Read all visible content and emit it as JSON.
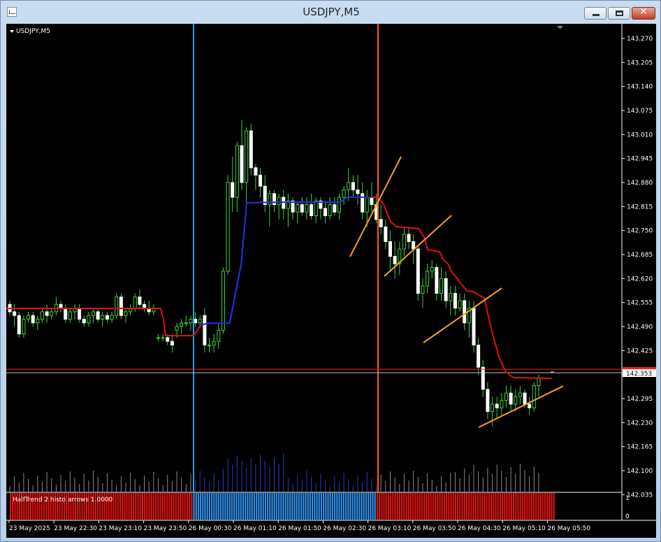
{
  "window": {
    "title": "USDJPY,M5"
  },
  "chart": {
    "symbol_label": "USDJPY,M5",
    "current_price_label": "142.353",
    "price_axis_labels": [
      "143.270",
      "143.205",
      "143.140",
      "143.075",
      "143.010",
      "142.945",
      "142.880",
      "142.815",
      "142.750",
      "142.685",
      "142.620",
      "142.555",
      "142.490",
      "142.425",
      "142.360",
      "142.295",
      "142.230",
      "142.165",
      "142.100",
      "142.035"
    ],
    "time_axis_labels": [
      "23 May 2025",
      "23 May 22:30",
      "23 May 23:10",
      "23 May 23:50",
      "26 May 00:30",
      "26 May 01:10",
      "26 May 01:50",
      "26 May 02:30",
      "26 May 03:10",
      "26 May 03:50",
      "26 May 04:30",
      "26 May 05:10",
      "26 May 05:50"
    ],
    "indicator_label": "HalfTrend 2 histo arrows 1.0000",
    "indicator_axis_labels": [
      "1",
      "0"
    ]
  },
  "chart_data": {
    "type": "candlestick",
    "title": "USDJPY,M5",
    "ylim": [
      142.035,
      143.27
    ],
    "y_ticks": [
      143.27,
      143.205,
      143.14,
      143.075,
      143.01,
      142.945,
      142.88,
      142.815,
      142.75,
      142.685,
      142.62,
      142.555,
      142.49,
      142.425,
      142.36,
      142.295,
      142.23,
      142.165,
      142.1,
      142.035
    ],
    "current_price": 142.353,
    "series": [
      {
        "name": "HalfTrend",
        "segments": [
          {
            "color": "red",
            "points": [
              [
                0,
                142.53
              ],
              [
                0.47,
                142.53
              ],
              [
                0.51,
                142.455
              ],
              [
                0.62,
                142.455
              ],
              [
                0.63,
                142.49
              ],
              [
                0.74,
                142.49
              ],
              [
                0.76,
                142.61
              ],
              [
                0.78,
                142.815
              ],
              [
                0.95,
                142.825
              ],
              [
                0.99,
                142.825
              ],
              [
                1.09,
                142.84
              ]
            ]
          },
          {
            "color": "red",
            "points": [
              [
                1.02,
                142.84
              ],
              [
                1.09,
                142.83
              ],
              [
                1.13,
                142.74
              ],
              [
                1.19,
                142.735
              ],
              [
                1.28,
                142.67
              ],
              [
                1.33,
                142.635
              ],
              [
                1.37,
                142.6
              ],
              [
                1.45,
                142.58
              ],
              [
                1.48,
                142.55
              ],
              [
                1.53,
                142.46
              ],
              [
                1.57,
                142.33
              ],
              [
                1.61,
                142.325
              ],
              [
                1.64,
                142.315
              ],
              [
                1.72,
                142.315
              ]
            ]
          }
        ]
      },
      {
        "name": "HalfTrend histogram",
        "colors": [
          "red",
          "blue",
          "red"
        ],
        "values": [
          1,
          1,
          1
        ]
      }
    ]
  }
}
